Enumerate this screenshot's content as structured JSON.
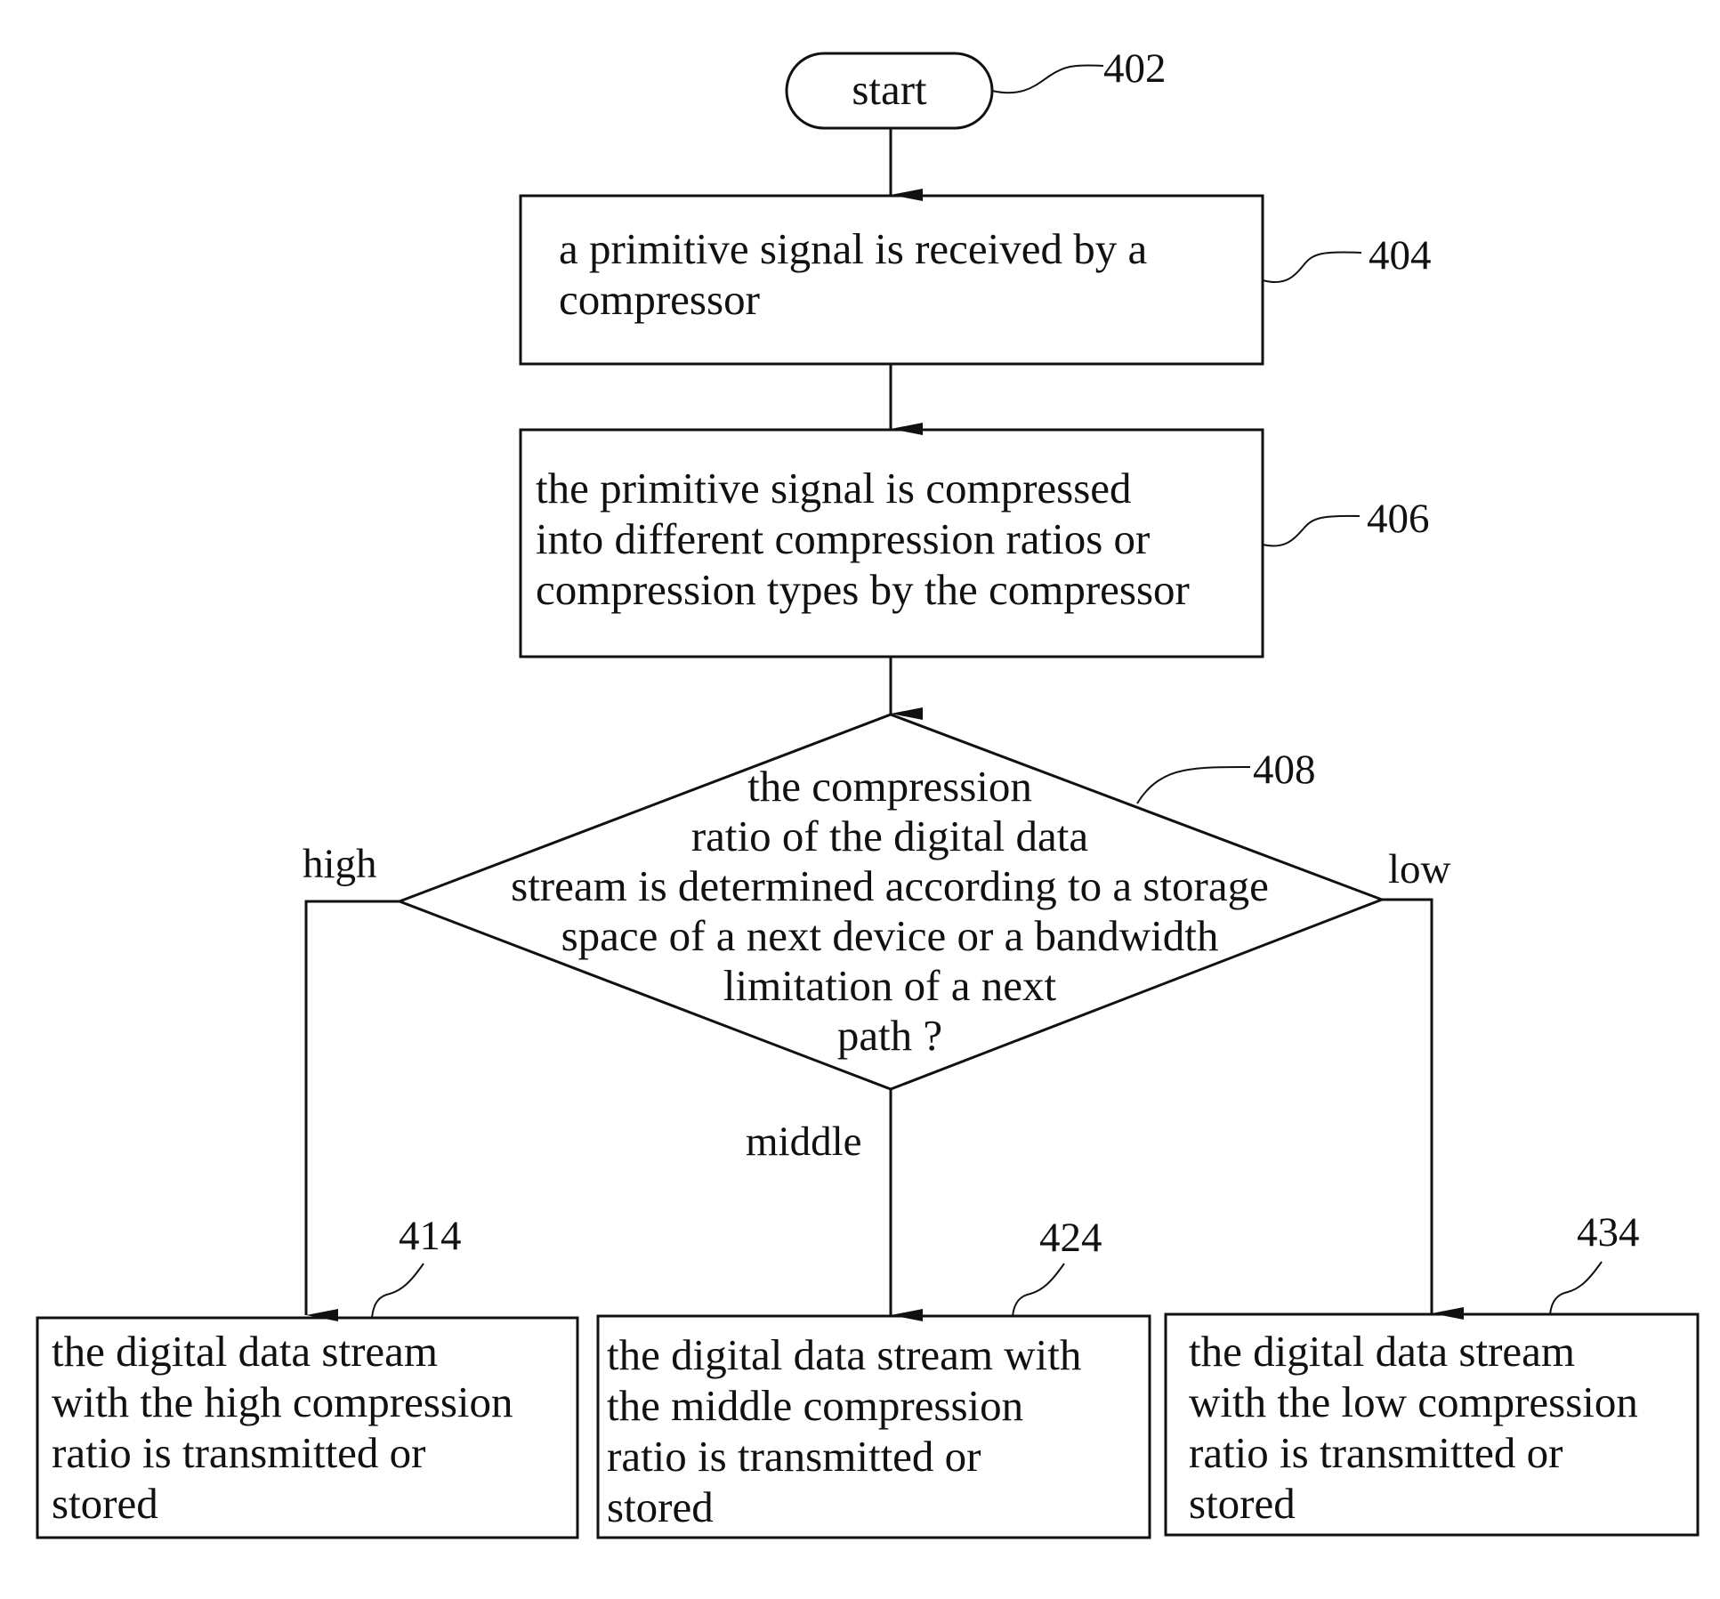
{
  "nodes": {
    "start": {
      "label": "start",
      "ref": "402"
    },
    "receive": {
      "label": "a primitive signal is received by a\ncompressor",
      "ref": "404"
    },
    "compress": {
      "label": "the primitive signal is compressed\ninto different compression ratios or\ncompression types by the compressor",
      "ref": "406"
    },
    "decision": {
      "label": "the compression\nratio of the digital data\nstream is determined according to a storage\nspace of a next device or a bandwidth\nlimitation of a next\npath ?",
      "ref": "408"
    },
    "high_out": {
      "label": "the digital data stream\nwith the high compression\nratio is transmitted or\nstored",
      "ref": "414"
    },
    "middle_out": {
      "label": "the digital data stream with\nthe middle compression\nratio is transmitted or\nstored",
      "ref": "424"
    },
    "low_out": {
      "label": "the digital data stream\nwith the low compression\nratio is transmitted or\nstored",
      "ref": "434"
    }
  },
  "branches": {
    "high": "high",
    "middle": "middle",
    "low": "low"
  },
  "colors": {
    "line": "#111111",
    "background": "#ffffff"
  }
}
